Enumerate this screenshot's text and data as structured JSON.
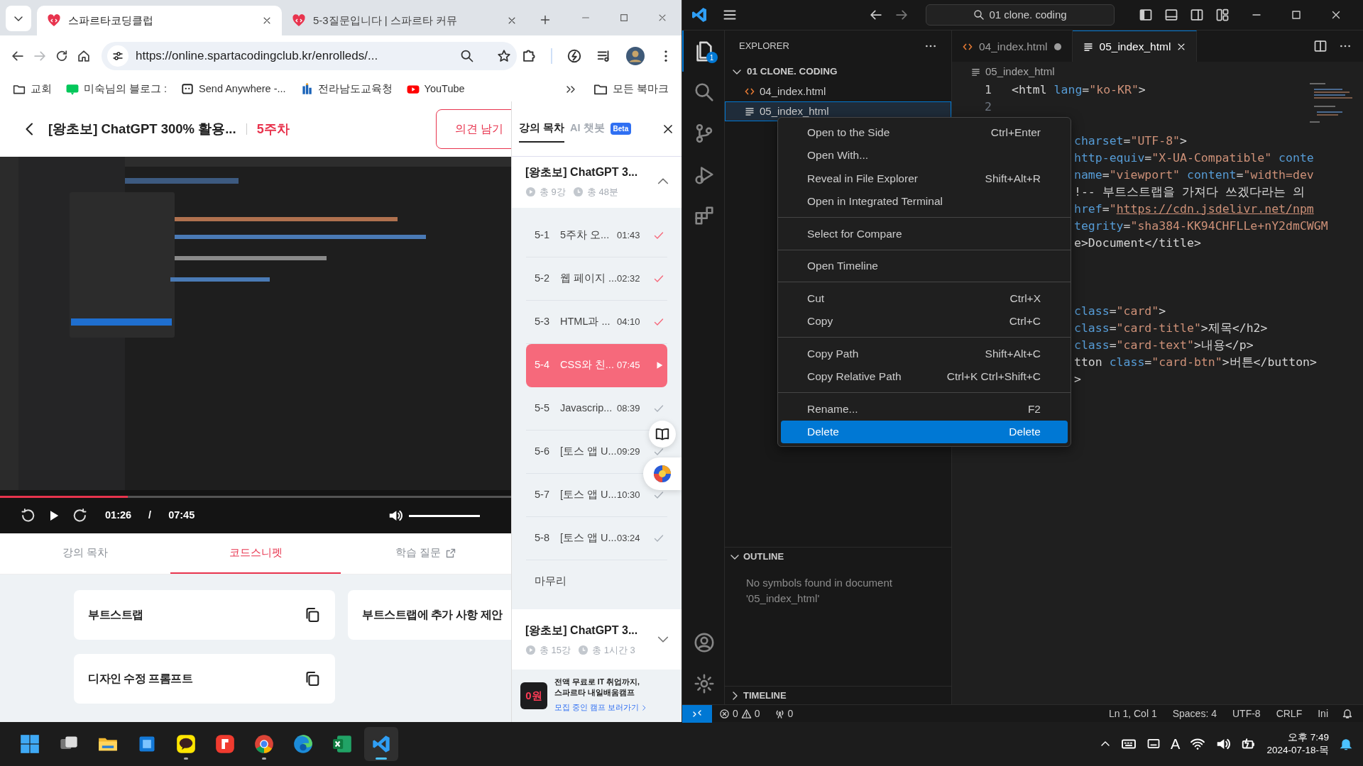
{
  "browser": {
    "tabs": [
      {
        "title": "스파르타코딩클럽",
        "selected": true
      },
      {
        "title": "5-3질문입니다 | 스파르타 커뮤",
        "selected": false
      }
    ],
    "nav_buttons": [
      {
        "kind": "back",
        "disabled": false
      },
      {
        "kind": "forward",
        "disabled": true
      },
      {
        "kind": "reload",
        "disabled": false
      },
      {
        "kind": "home",
        "disabled": false
      }
    ],
    "url": "https://online.spartacodingclub.kr/enrolleds/...",
    "bookmarks": [
      {
        "kind": "folder",
        "label": "교회"
      },
      {
        "kind": "blog",
        "label": "미숙님의 블로그 :"
      },
      {
        "kind": "send",
        "label": "Send Anywhere -..."
      },
      {
        "kind": "edu",
        "label": "전라남도교육청"
      },
      {
        "kind": "youtube",
        "label": "YouTube"
      }
    ],
    "all_bookmarks": "모든 북마크"
  },
  "course": {
    "title": "[왕초보] ChatGPT 300% 활용...",
    "week": "5주차",
    "feedback_button": "의견 남기",
    "player": {
      "progress": {
        "level": 0.25
      },
      "current": "01:26",
      "separator": "/",
      "duration": "07:45",
      "volume": {
        "level": 1
      }
    },
    "content_tabs": [
      {
        "label": "강의 목차",
        "selected": false,
        "external": false
      },
      {
        "label": "코드스니펫",
        "selected": true,
        "external": false
      },
      {
        "label": "학습 질문",
        "selected": false,
        "external": true
      }
    ],
    "snippets": [
      {
        "title": "부트스트랩",
        "copy_icon": true
      },
      {
        "title": "부트스트랩에 추가 사항 제안",
        "copy_icon": false
      },
      {
        "title": "디자인 수정 프롬프트",
        "copy_icon": true
      }
    ]
  },
  "side_panel": {
    "tabs": [
      {
        "label": "강의 목차",
        "selected": true
      },
      {
        "label": "AI 챗봇",
        "selected": false,
        "badge": "Beta"
      }
    ],
    "sections": [
      {
        "title": "[왕초보] ChatGPT 3...",
        "lesson_count": "총 9강",
        "length": "총 48분",
        "expanded": true,
        "lessons": [
          {
            "kind": "lesson",
            "number": "5-1",
            "title": "5주차 오...",
            "time": "01:43",
            "watched": true,
            "selected": false
          },
          {
            "kind": "lesson",
            "number": "5-2",
            "title": "웹 페이지 ...",
            "time": "02:32",
            "watched": true,
            "selected": false
          },
          {
            "kind": "lesson",
            "number": "5-3",
            "title": "HTML과 ...",
            "time": "04:10",
            "watched": true,
            "selected": false
          },
          {
            "kind": "lesson",
            "number": "5-4",
            "title": "CSS와 친...",
            "time": "07:45",
            "watched": false,
            "selected": true
          },
          {
            "kind": "lesson",
            "number": "5-5",
            "title": "Javascrip...",
            "time": "08:39",
            "watched": false,
            "selected": false
          },
          {
            "kind": "lesson",
            "number": "5-6",
            "title": "[토스 앱 U...",
            "time": "09:29",
            "watched": false,
            "selected": false
          },
          {
            "kind": "lesson",
            "number": "5-7",
            "title": "[토스 앱 U...",
            "time": "10:30",
            "watched": false,
            "selected": false
          },
          {
            "kind": "lesson",
            "number": "5-8",
            "title": "[토스 앱 U...",
            "time": "03:24",
            "watched": false,
            "selected": false
          },
          {
            "kind": "outro",
            "title": "마무리"
          }
        ]
      },
      {
        "title": "[왕초보] ChatGPT 3...",
        "lesson_count": "총 15강",
        "length": "총 1시간 3",
        "expanded": false
      }
    ],
    "ad": {
      "thumb": "0원",
      "lines": [
        "전액 무료로 IT 취업까지,",
        "스파르타 내일배움캠프"
      ],
      "link": "모집 중인 캠프 보러가기"
    }
  },
  "vscode": {
    "search": "01 clone. coding",
    "activity": [
      {
        "kind": "explorer",
        "selected": true,
        "badge": "1"
      },
      {
        "kind": "search",
        "selected": false
      },
      {
        "kind": "scm",
        "selected": false
      },
      {
        "kind": "debug",
        "selected": false
      },
      {
        "kind": "extensions",
        "selected": false
      }
    ],
    "explorer": {
      "title": "EXPLORER",
      "folder": {
        "name": "01 CLONE. CODING",
        "expanded": true,
        "children": [
          {
            "name": "04_index.html",
            "kind": "html",
            "selected": false
          },
          {
            "name": "05_index_html",
            "kind": "text",
            "selected": true
          }
        ]
      }
    },
    "outline": {
      "title": "OUTLINE",
      "expanded": true,
      "message": "No symbols found in document '05_index_html'"
    },
    "timeline": {
      "title": "TIMELINE",
      "expanded": false
    },
    "tabs": [
      {
        "name": "04_index.html",
        "kind": "html",
        "modified": true,
        "selected": false
      },
      {
        "name": "05_index_html",
        "kind": "text",
        "modified": false,
        "selected": true
      }
    ],
    "breadcrumb": "05_index_html",
    "code": [
      {
        "kind": "full",
        "number": "1",
        "tokens": [
          {
            "kind": "plain",
            "text": "<html "
          },
          {
            "kind": "attr",
            "text": "lang"
          },
          {
            "kind": "plain",
            "text": "="
          },
          {
            "kind": "str",
            "text": "\"ko-KR\""
          },
          {
            "kind": "plain",
            "text": ">"
          }
        ]
      },
      {
        "kind": "full",
        "number": "2"
      },
      {
        "kind": "blank"
      },
      {
        "kind": "partial",
        "tokens": [
          {
            "kind": "attr",
            "text": "charset"
          },
          {
            "kind": "plain",
            "text": "="
          },
          {
            "kind": "str",
            "text": "\"UTF-8\""
          },
          {
            "kind": "plain",
            "text": ">"
          }
        ]
      },
      {
        "kind": "partial",
        "tokens": [
          {
            "kind": "attr",
            "text": "http-equiv"
          },
          {
            "kind": "plain",
            "text": "="
          },
          {
            "kind": "str",
            "text": "\"X-UA-Compatible\" "
          },
          {
            "kind": "attr",
            "text": "conte"
          }
        ]
      },
      {
        "kind": "partial",
        "tokens": [
          {
            "kind": "attr",
            "text": "name"
          },
          {
            "kind": "plain",
            "text": "="
          },
          {
            "kind": "str",
            "text": "\"viewport\" "
          },
          {
            "kind": "attr",
            "text": "content"
          },
          {
            "kind": "plain",
            "text": "="
          },
          {
            "kind": "str",
            "text": "\"width=dev"
          }
        ]
      },
      {
        "kind": "partial",
        "tokens": [
          {
            "kind": "plain",
            "text": "!-- 부트스트랩을 가져다 쓰겠다라는 의"
          }
        ]
      },
      {
        "kind": "partial",
        "tokens": [
          {
            "kind": "attr",
            "text": "href"
          },
          {
            "kind": "plain",
            "text": "="
          },
          {
            "kind": "str",
            "text": "\""
          },
          {
            "kind": "link",
            "text": "https://cdn.jsdelivr.net/npm"
          }
        ]
      },
      {
        "kind": "partial",
        "tokens": [
          {
            "kind": "attr",
            "text": "tegrity"
          },
          {
            "kind": "plain",
            "text": "="
          },
          {
            "kind": "str",
            "text": "\"sha384-KK94CHFLLe+nY2dmCWGM"
          }
        ]
      },
      {
        "kind": "partial",
        "tokens": [
          {
            "kind": "plain",
            "text": "e>Document</title>"
          }
        ]
      },
      {
        "kind": "blank"
      },
      {
        "kind": "blank"
      },
      {
        "kind": "blank"
      },
      {
        "kind": "partial",
        "tokens": [
          {
            "kind": "attr",
            "text": "class"
          },
          {
            "kind": "plain",
            "text": "="
          },
          {
            "kind": "str",
            "text": "\"card\""
          },
          {
            "kind": "plain",
            "text": ">"
          }
        ]
      },
      {
        "kind": "partial",
        "tokens": [
          {
            "kind": "attr",
            "text": "class"
          },
          {
            "kind": "plain",
            "text": "="
          },
          {
            "kind": "str",
            "text": "\"card-title\""
          },
          {
            "kind": "plain",
            "text": ">제목</h2>"
          }
        ]
      },
      {
        "kind": "partial",
        "tokens": [
          {
            "kind": "attr",
            "text": "class"
          },
          {
            "kind": "plain",
            "text": "="
          },
          {
            "kind": "str",
            "text": "\"card-text\""
          },
          {
            "kind": "plain",
            "text": ">내용</p>"
          }
        ]
      },
      {
        "kind": "partial",
        "tokens": [
          {
            "kind": "plain",
            "text": "tton "
          },
          {
            "kind": "attr",
            "text": "class"
          },
          {
            "kind": "plain",
            "text": "="
          },
          {
            "kind": "str",
            "text": "\"card-btn\""
          },
          {
            "kind": "plain",
            "text": ">버튼</button>"
          }
        ]
      },
      {
        "kind": "partial",
        "tokens": [
          {
            "kind": "plain",
            "text": ">"
          }
        ]
      }
    ],
    "context_menu": [
      [
        {
          "label": "Open to the Side",
          "shortcut": "Ctrl+Enter",
          "selected": false
        },
        {
          "label": "Open With...",
          "selected": false
        },
        {
          "label": "Reveal in File Explorer",
          "shortcut": "Shift+Alt+R",
          "selected": false
        },
        {
          "label": "Open in Integrated Terminal",
          "selected": false
        }
      ],
      [
        {
          "label": "Select for Compare",
          "selected": false
        }
      ],
      [
        {
          "label": "Open Timeline",
          "selected": false
        }
      ],
      [
        {
          "label": "Cut",
          "shortcut": "Ctrl+X",
          "selected": false
        },
        {
          "label": "Copy",
          "shortcut": "Ctrl+C",
          "selected": false
        }
      ],
      [
        {
          "label": "Copy Path",
          "shortcut": "Shift+Alt+C",
          "selected": false
        },
        {
          "label": "Copy Relative Path",
          "shortcut": "Ctrl+K Ctrl+Shift+C",
          "selected": false
        }
      ],
      [
        {
          "label": "Rename...",
          "shortcut": "F2",
          "selected": false
        },
        {
          "label": "Delete",
          "shortcut": "Delete",
          "selected": true
        }
      ]
    ],
    "status_bar": {
      "errors": "0",
      "warnings": "0",
      "ports": "0",
      "items": [
        "Ln 1, Col 1",
        "Spaces: 4",
        "UTF-8",
        "CRLF",
        "Ini"
      ]
    }
  },
  "taskbar": {
    "apps": [
      {
        "kind": "start",
        "running": false,
        "selected": false
      },
      {
        "kind": "taskview",
        "running": false,
        "selected": false
      },
      {
        "kind": "files",
        "running": false,
        "selected": false
      },
      {
        "kind": "bluebox",
        "running": false,
        "selected": false
      },
      {
        "kind": "talk",
        "running": true,
        "selected": false
      },
      {
        "kind": "redapp",
        "running": false,
        "selected": false
      },
      {
        "kind": "chrome",
        "running": true,
        "selected": false
      },
      {
        "kind": "edge",
        "running": false,
        "selected": false
      },
      {
        "kind": "excel",
        "running": false,
        "selected": false
      },
      {
        "kind": "code",
        "running": true,
        "selected": true
      }
    ],
    "ime": "A",
    "time": "오후 7:49",
    "date": "2024-07-18-목"
  }
}
